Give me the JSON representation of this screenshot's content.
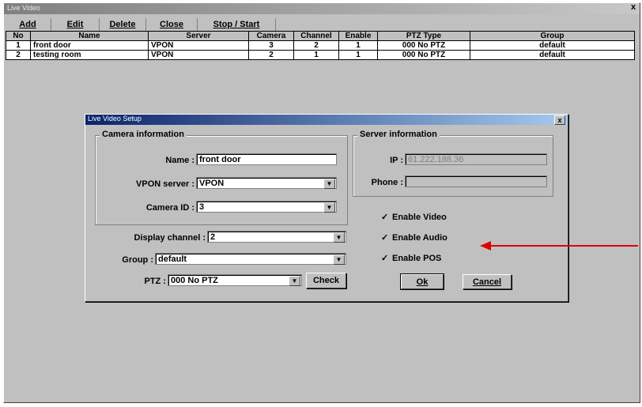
{
  "window": {
    "title": "Live Video",
    "close": "x"
  },
  "toolbar": {
    "add": "Add",
    "edit": "Edit",
    "delete": "Delete",
    "close": "Close",
    "stop_start": "Stop / Start"
  },
  "grid": {
    "headers": [
      "No",
      "Name",
      "Server",
      "Camera",
      "Channel",
      "Enable",
      "PTZ Type",
      "Group"
    ],
    "rows": [
      [
        "1",
        "front door",
        "VPON",
        "3",
        "2",
        "1",
        "000 No PTZ",
        "default"
      ],
      [
        "2",
        "testing room",
        "VPON",
        "2",
        "1",
        "1",
        "000 No PTZ",
        "default"
      ]
    ]
  },
  "dialog": {
    "title": "Live Video Setup",
    "close": "x",
    "camera_info": {
      "group_label": "Camera information",
      "name_label": "Name :",
      "name_value": "front door",
      "server_label": "VPON server :",
      "server_value": "VPON",
      "camera_label": "Camera ID :",
      "camera_value": "3"
    },
    "server_info": {
      "group_label": "Server information",
      "ip_label": "IP :",
      "ip_value": "61.222.188.36",
      "phone_label": "Phone :",
      "phone_value": ""
    },
    "display_label": "Display channel :",
    "display_value": "2",
    "group_label": "Group :",
    "group_value": "default",
    "ptz_label": "PTZ :",
    "ptz_value": "000 No PTZ",
    "check": "Check",
    "enable_video": "Enable Video",
    "enable_audio": "Enable Audio",
    "enable_pos": "Enable POS",
    "ok": "Ok",
    "cancel": "Cancel"
  },
  "colors": {
    "annotation_arrow": "#e00000"
  }
}
